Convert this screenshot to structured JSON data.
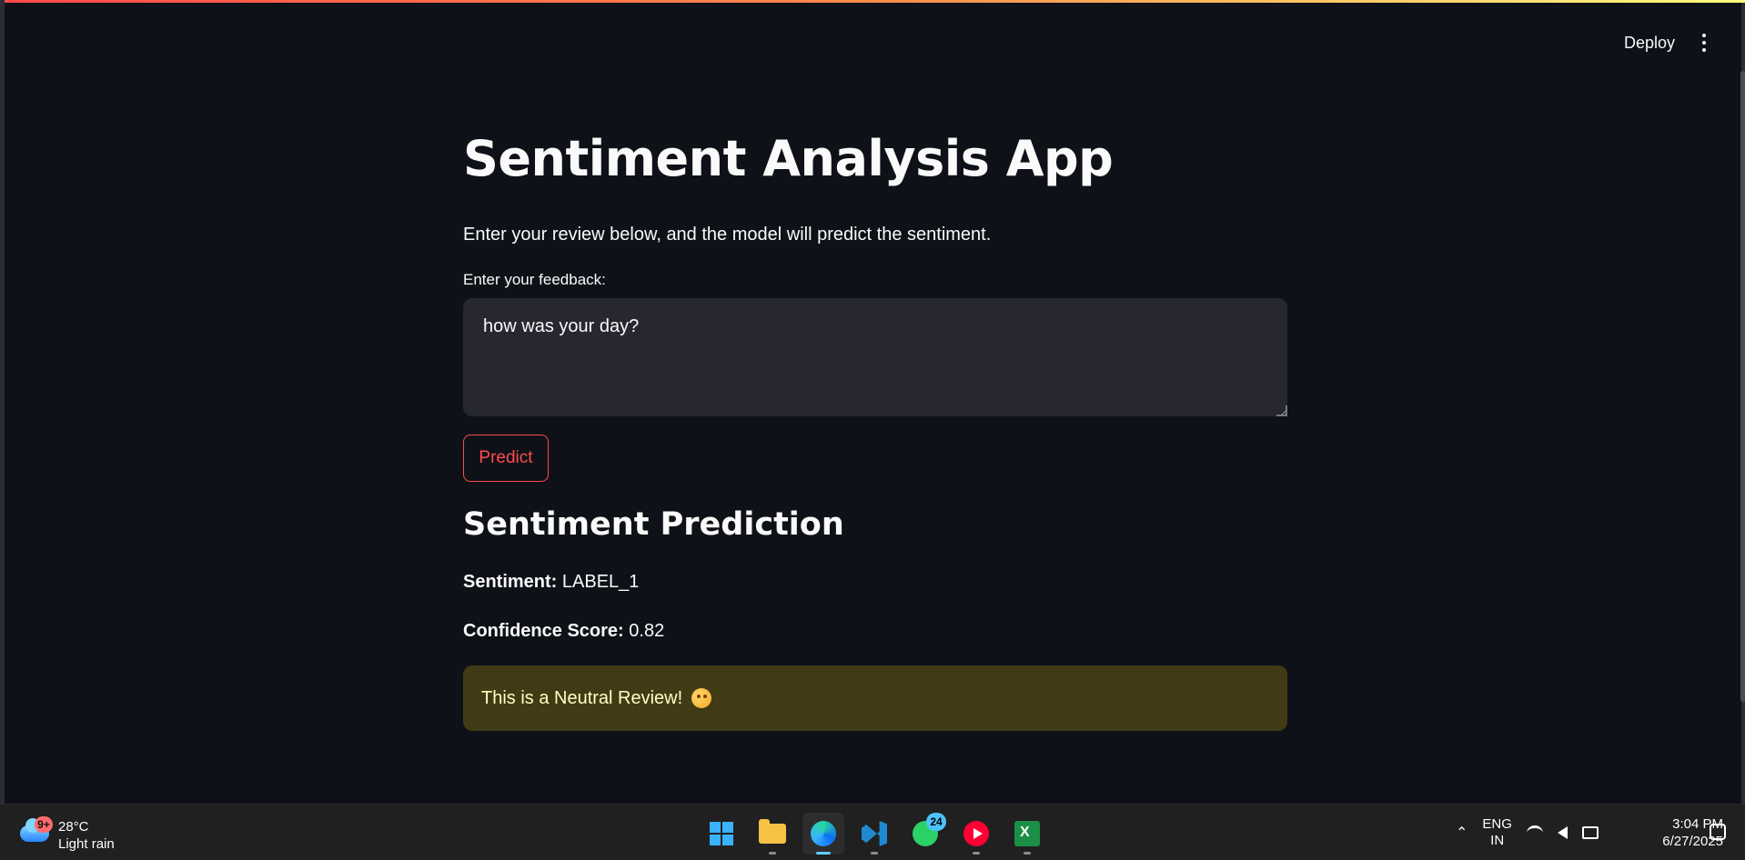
{
  "header": {
    "deploy_label": "Deploy"
  },
  "main": {
    "title": "Sentiment Analysis App",
    "intro": "Enter your review below, and the model will predict the sentiment.",
    "feedback_label": "Enter your feedback:",
    "feedback_value": "how was your day?",
    "predict_label": "Predict",
    "result_heading": "Sentiment Prediction",
    "sentiment_label": "Sentiment:",
    "sentiment_value": "LABEL_1",
    "confidence_label": "Confidence Score:",
    "confidence_value": "0.82",
    "alert_text": "This is a Neutral Review!"
  },
  "taskbar": {
    "weather": {
      "badge": "9+",
      "temperature": "28°C",
      "condition": "Light rain"
    },
    "apps": [
      {
        "name": "start"
      },
      {
        "name": "file-explorer"
      },
      {
        "name": "edge"
      },
      {
        "name": "vscode"
      },
      {
        "name": "whatsapp",
        "badge": "24"
      },
      {
        "name": "youtube-music"
      },
      {
        "name": "excel"
      }
    ],
    "tray": {
      "language_top": "ENG",
      "language_bottom": "IN",
      "time": "3:04 PM",
      "date": "6/27/2025"
    }
  },
  "colors": {
    "page_bg": "#0e1117",
    "accent": "#ff4b4b",
    "alert_bg": "#403b15",
    "alert_text": "#ffffc2"
  }
}
